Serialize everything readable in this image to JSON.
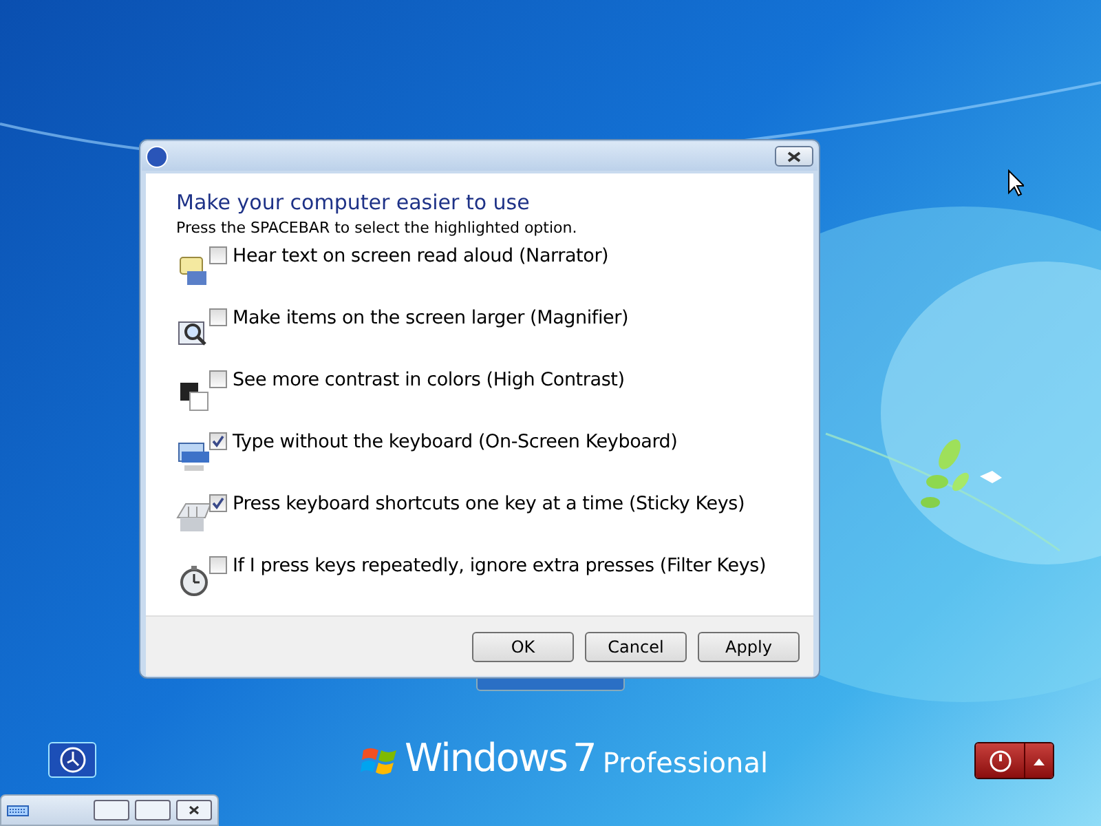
{
  "dialog": {
    "heading": "Make your computer easier to use",
    "instruction": "Press the SPACEBAR to select the highlighted option.",
    "options": [
      {
        "kind": "narrator",
        "label": "Hear text on screen read aloud (Narrator)",
        "checked": false
      },
      {
        "kind": "magnifier",
        "label": "Make items on the screen larger (Magnifier)",
        "checked": false
      },
      {
        "kind": "contrast",
        "label": "See more contrast in colors (High Contrast)",
        "checked": false
      },
      {
        "kind": "keyboard",
        "label": "Type without the keyboard (On-Screen Keyboard)",
        "checked": true
      },
      {
        "kind": "sticky",
        "label": "Press keyboard shortcuts one key at a time (Sticky Keys)",
        "checked": true
      },
      {
        "kind": "filter",
        "label": "If I press keys repeatedly, ignore extra presses (Filter Keys)",
        "checked": false
      }
    ],
    "buttons": [
      "OK",
      "Cancel",
      "Apply"
    ]
  },
  "branding": {
    "brand": "Windows",
    "version": "7",
    "edition": "Professional"
  }
}
